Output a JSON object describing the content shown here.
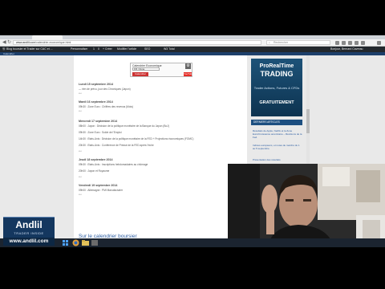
{
  "browser": {
    "url_host": "www.andlil.com",
    "url_rest": "/calendrier-economique.html",
    "search_placeholder": "Rechercher"
  },
  "wpbar": {
    "items": [
      "Blog boursier et Trader sur CAC et ...",
      "Personnaliser",
      "1",
      "0",
      "+ Créer",
      "Modifier l'article",
      "SEO",
      "W3 Total"
    ],
    "user": "Bonjour, Bernard Cavreau"
  },
  "site_strip": {
    "label": "Calendrier"
  },
  "calendar_widget": {
    "title": "Calendrier Economique",
    "select_value": "FR / Zone",
    "button_label": "Calendrier",
    "youtube_label": "YouTube"
  },
  "days": [
    {
      "title": "Lundi 15 septembre 2014",
      "events": [
        "— rien de prévu, jour des Chroniques (Japon)"
      ]
    },
    {
      "title": "Mardi 16 septembre 2014",
      "events": [
        "09h30 : Zone Euro : Chiffres des revenus (Mois)"
      ]
    },
    {
      "title": "Mercredi 17 septembre 2014",
      "events": [
        "08h00 : Japon : Décision de la politique monétaire de la Banque du Japon (BoJ)",
        "09h30 : Zone Euro : Solde de l'Emploi",
        "14h30 : Etats-Unis : Décision de la politique monétaire de la FED + Projections économiques (FOMC)",
        "20h30 : Etats-Unis : Conférence de Presse de la FED après l'éche"
      ]
    },
    {
      "title": "Jeudi 18 septembre 2014",
      "events": [
        "09h30 : Etats-Unis : Inscriptions hebdomadaires au chômage",
        "20h00 : Japon et Royaume"
      ]
    },
    {
      "title": "Vendredi 19 septembre 2014",
      "events": [
        "09h00 : Allemagne : PMI Manufacturier"
      ]
    }
  ],
  "calendar_heading": "Sur le calendrier boursier",
  "sidebar": {
    "ad_brand_top": "ProRealTime",
    "ad_brand_main": "TRADING",
    "ad_subtitle": "Trader Actions, Futures & CFDs",
    "ad_cta": "GRATUITEMENT",
    "heading": "DERNIERS ARTICLES",
    "links": [
      "Résultats de Apple, Netflix et la Zone Euro/Croissance américaine – Révisions de la Fed.",
      "Indices européens, et notes de marché du 1 au 5 septembre",
      "Présentation des résultats"
    ]
  },
  "logo": {
    "word": "Andlil",
    "tagline": "TRADER INSIDE",
    "url": "www.andlil.com"
  },
  "colors": {
    "accent": "#2a5ba0",
    "wp_admin": "#23282d",
    "ad_blue": "#1d5278",
    "logo_blue": "#14375f"
  }
}
